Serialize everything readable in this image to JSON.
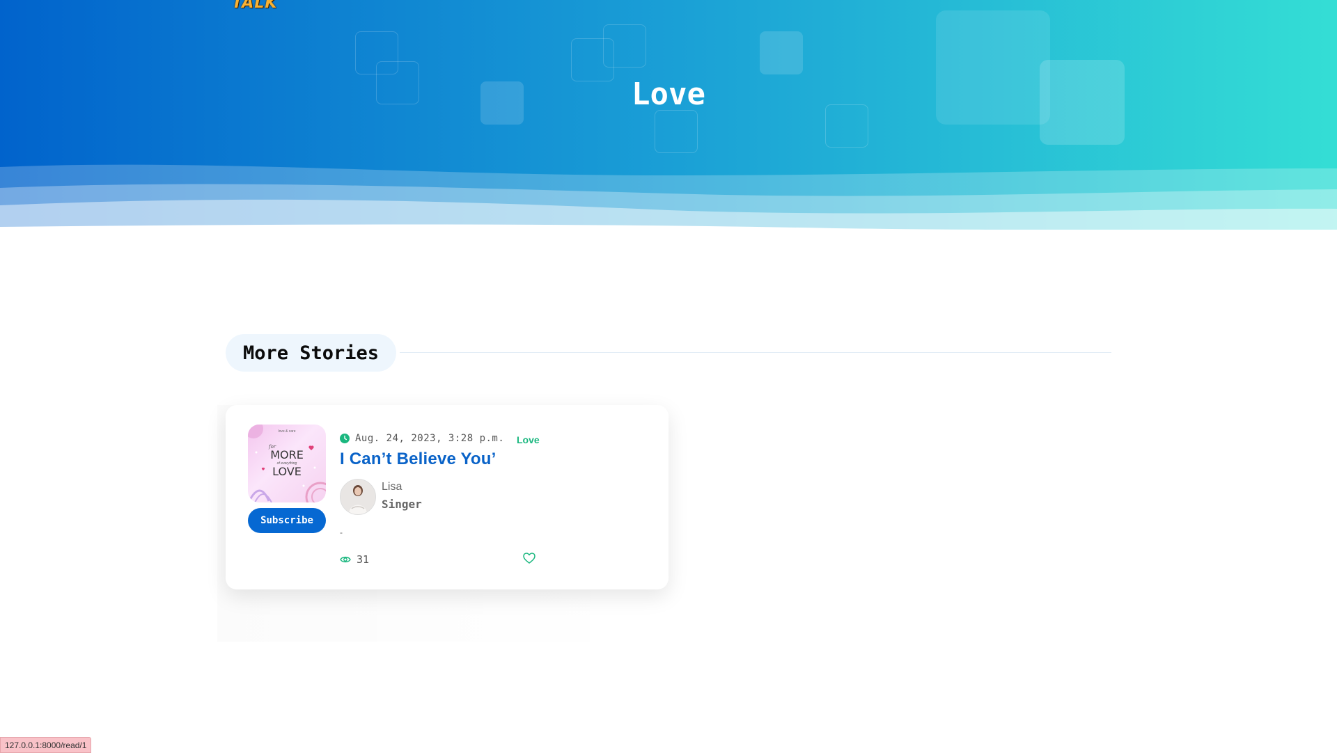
{
  "header": {
    "logo_text": "TALK",
    "page_title": "Love"
  },
  "section": {
    "title": "More Stories"
  },
  "story": {
    "subscribe_label": "Subscribe",
    "date": "Aug. 24, 2023, 3:28 p.m.",
    "category": "Love",
    "title": "I Can’t Believe You’",
    "author_name": "Lisa",
    "author_role": "Singer",
    "excerpt": "-",
    "views": "31",
    "thumbnail_text": {
      "top": "love & care",
      "line1": "for",
      "line2": "MORE",
      "line3": "of everything",
      "line4": "LOVE"
    }
  },
  "status_bar": {
    "url": "127.0.0.1:8000/read/1"
  },
  "colors": {
    "brand_blue": "#0668d2",
    "accent_green": "#1ab77f",
    "hero_start": "#0163cc",
    "hero_end": "#34ded5"
  }
}
